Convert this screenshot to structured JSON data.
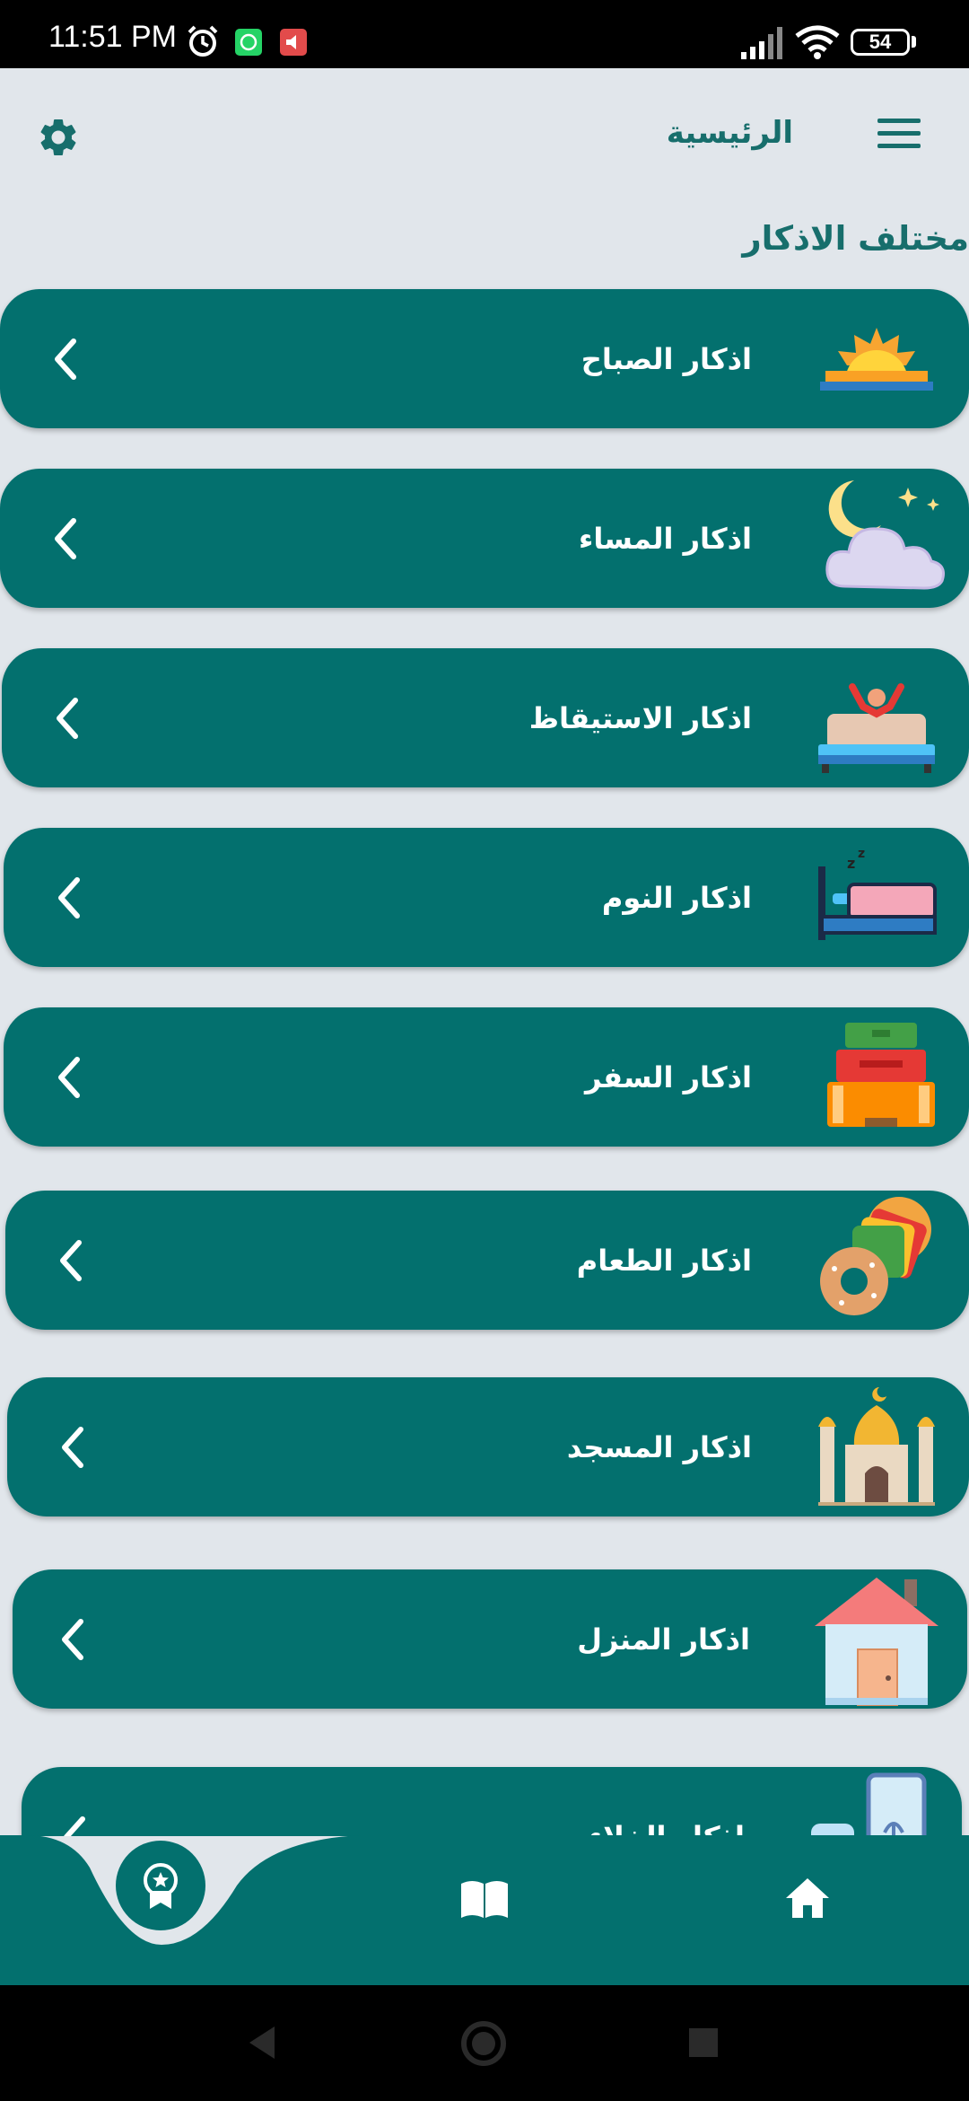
{
  "status_bar": {
    "time": "11:51 PM",
    "battery": "54",
    "icons": [
      "alarm-icon",
      "whatsapp-icon",
      "notification-app-icon",
      "signal-icon",
      "wifi-icon",
      "battery-icon"
    ]
  },
  "header": {
    "title": "الرئيسية",
    "menu_icon": "menu-icon",
    "settings_icon": "gear-icon"
  },
  "section_title": "مختلف الاذكار",
  "cards": [
    {
      "label": "اذكار الصباح",
      "icon": "sunrise-icon"
    },
    {
      "label": "اذكار المساء",
      "icon": "night-cloud-icon"
    },
    {
      "label": "اذكار الاستيقاظ",
      "icon": "wake-up-bed-icon"
    },
    {
      "label": "اذكار النوم",
      "icon": "sleep-bed-icon"
    },
    {
      "label": "اذكار السفر",
      "icon": "suitcases-icon"
    },
    {
      "label": "اذكار الطعام",
      "icon": "food-icon"
    },
    {
      "label": "اذكار المسجد",
      "icon": "mosque-icon"
    },
    {
      "label": "اذكار المنزل",
      "icon": "house-icon"
    },
    {
      "label": "اذكار الخلاء",
      "icon": "bathroom-icon"
    }
  ],
  "bottom_nav": {
    "items": [
      "award-icon",
      "book-icon",
      "home-icon"
    ],
    "active": "award-icon"
  },
  "colors": {
    "primary": "#03706E",
    "title": "#176E6C",
    "background": "#E1E6EB"
  }
}
